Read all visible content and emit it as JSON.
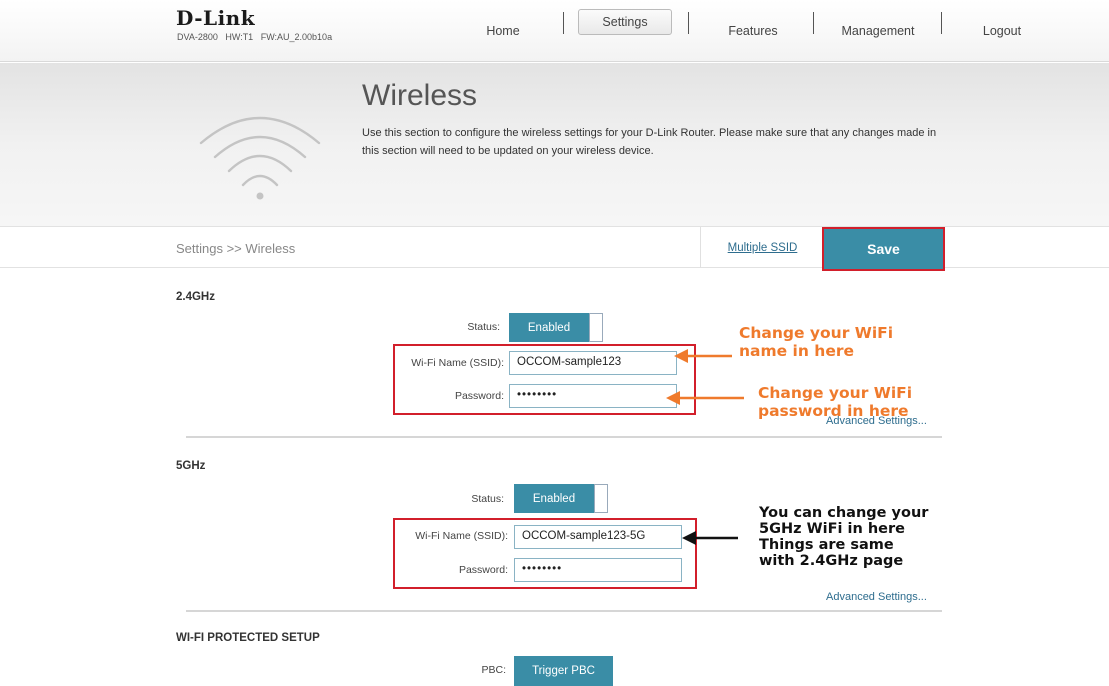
{
  "header": {
    "logo": "D-Link",
    "device_info": "DVA-2800   HW:T1   FW:AU_2.00b10a",
    "nav": {
      "home": "Home",
      "settings": "Settings",
      "features": "Features",
      "management": "Management",
      "logout": "Logout"
    }
  },
  "hero": {
    "title": "Wireless",
    "description": "Use this section to configure the wireless settings for your D-Link Router. Please make sure that any changes made in this section will need to be updated on your wireless device.",
    "icon": "wifi-icon"
  },
  "toolbar": {
    "breadcrumb": "Settings >> Wireless",
    "multiple_ssid": "Multiple SSID",
    "save": "Save"
  },
  "band_24": {
    "title": "2.4GHz",
    "status_label": "Status:",
    "status_value": "Enabled",
    "ssid_label": "Wi-Fi Name (SSID):",
    "ssid_value": "OCCOM-sample123",
    "password_label": "Password:",
    "password_value": "••••••••",
    "advanced": "Advanced Settings..."
  },
  "band_5": {
    "title": "5GHz",
    "status_label": "Status:",
    "status_value": "Enabled",
    "ssid_label": "Wi-Fi Name (SSID):",
    "ssid_value": "OCCOM-sample123-5G",
    "password_label": "Password:",
    "password_value": "••••••••",
    "advanced": "Advanced Settings..."
  },
  "wps": {
    "title": "WI-FI PROTECTED SETUP",
    "pbc_label": "PBC:",
    "pbc_button": "Trigger PBC"
  },
  "annotations": {
    "ssid_note_line1": "Change your WiFi",
    "ssid_note_line2": "name in here",
    "password_note_line1": "Change your WiFi",
    "password_note_line2": "password in here",
    "band5_note_line1": "You can change your",
    "band5_note_line2": "5GHz WiFi in here",
    "band5_note_line3": "Things are same",
    "band5_note_line4": "with 2.4GHz page"
  },
  "colors": {
    "accent": "#3a8da6",
    "highlight_frame": "#d21f2b",
    "annotation_orange": "#ef7a2c",
    "link": "#2e6d8e"
  }
}
